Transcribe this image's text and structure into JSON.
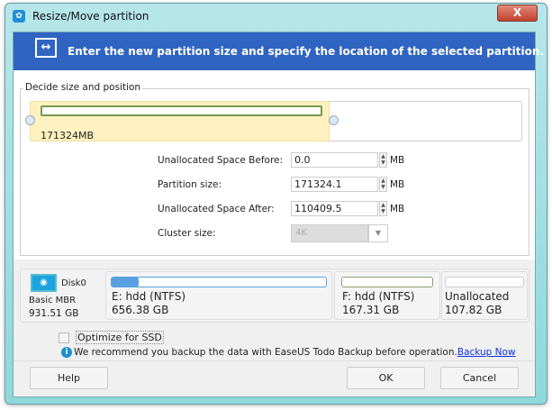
{
  "window": {
    "title": "Resize/Move partition",
    "close_label": "X"
  },
  "banner": {
    "icon": "resize-arrows-icon",
    "text": "Enter the new partition size and specify the location of the selected partition."
  },
  "group": {
    "label": "Decide size and position",
    "bar_size_text": "171324MB",
    "used_fraction": 0.608
  },
  "fields": {
    "before": {
      "label": "Unallocated Space Before:",
      "value": "0.0",
      "unit": "MB"
    },
    "size": {
      "label": "Partition size:",
      "value": "171324.1",
      "unit": "MB"
    },
    "after": {
      "label": "Unallocated Space After:",
      "value": "110409.5",
      "unit": "MB"
    },
    "cluster": {
      "label": "Cluster size:",
      "value": "4K"
    }
  },
  "disk": {
    "name": "Disk0",
    "type": "Basic MBR",
    "size": "931.51 GB",
    "partitions": [
      {
        "name": "E: hdd (NTFS)",
        "size": "656.38 GB",
        "color": "#5aa0e0"
      },
      {
        "name": "F: hdd (NTFS)",
        "size": "167.31 GB",
        "color": "#8aa070"
      },
      {
        "name": "Unallocated",
        "size": "107.82 GB",
        "color": "#cccccc"
      }
    ]
  },
  "optimize_label": "Optimize for SSD",
  "info": {
    "text": "We recommend you backup the data with EaseUS Todo Backup before operation.",
    "link": "Backup Now"
  },
  "buttons": {
    "help": "Help",
    "ok": "OK",
    "cancel": "Cancel"
  }
}
